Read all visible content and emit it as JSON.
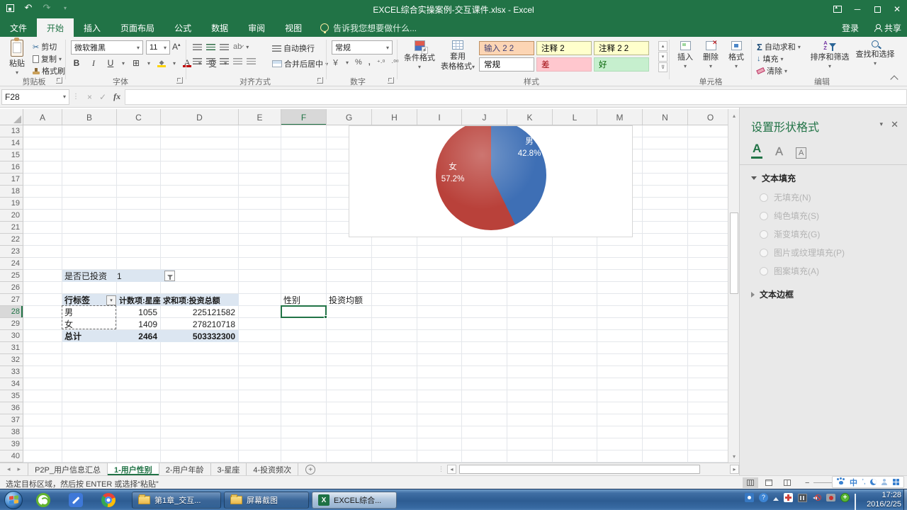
{
  "window": {
    "title": "EXCEL综合实操案例-交互课件.xlsx - Excel",
    "signin_label": "登录",
    "share_label": "共享"
  },
  "ribbon_tabs": [
    {
      "label": "文件",
      "kind": "file"
    },
    {
      "label": "开始",
      "active": true
    },
    {
      "label": "插入"
    },
    {
      "label": "页面布局"
    },
    {
      "label": "公式"
    },
    {
      "label": "数据"
    },
    {
      "label": "审阅"
    },
    {
      "label": "视图"
    }
  ],
  "tell_me": "告诉我您想要做什么...",
  "ribbon": {
    "clipboard": {
      "label": "剪贴板",
      "paste": "粘贴",
      "cut": "剪切",
      "copy": "复制",
      "painter": "格式刷"
    },
    "font": {
      "label": "字体",
      "font_name": "微软雅黑",
      "font_size": "11",
      "bold": "B",
      "italic": "I",
      "underline": "U",
      "phonetic": "变"
    },
    "alignment": {
      "label": "对齐方式",
      "wrap": "自动换行",
      "merge": "合并后居中"
    },
    "number": {
      "label": "数字",
      "format": "常规",
      "percent": "%",
      "comma": ",",
      "inc_dec": "+.0 .00"
    },
    "styles": {
      "label": "样式",
      "conditional": "条件格式",
      "format_table_1": "套用",
      "format_table_2": "表格格式",
      "gallery": [
        {
          "label": "输入 2 2",
          "bg": "#FCD5B4",
          "fg": "#3F3F76",
          "border": "#bd8f62"
        },
        {
          "label": "注释 2",
          "bg": "#FFFFCC",
          "fg": "#000000",
          "border": "#b8b88a"
        },
        {
          "label": "注释 2 2",
          "bg": "#FFFFCC",
          "fg": "#000000",
          "border": "#b8b88a"
        },
        {
          "label": "常规",
          "bg": "#FFFFFF",
          "fg": "#000000",
          "border": "#ababab"
        },
        {
          "label": "差",
          "bg": "#FFC7CE",
          "fg": "#9C0006",
          "border": "#eab6bd"
        },
        {
          "label": "好",
          "bg": "#C6EFCE",
          "fg": "#006100",
          "border": "#aedcb8"
        }
      ]
    },
    "cells": {
      "label": "单元格",
      "insert": "插入",
      "delete": "删除",
      "format": "格式"
    },
    "editing": {
      "label": "编辑",
      "autosum": "自动求和",
      "fill": "填充",
      "clear": "清除",
      "sort": "排序和筛选",
      "find": "查找和选择"
    }
  },
  "formula_bar": {
    "name_box": "F28",
    "fx": "fx"
  },
  "grid": {
    "columns": [
      "A",
      "B",
      "C",
      "D",
      "E",
      "F",
      "G",
      "H",
      "I",
      "J",
      "K",
      "L",
      "M",
      "N",
      "O"
    ],
    "row_first": 13,
    "row_last": 40,
    "selected_column": "F",
    "selected_row": 28
  },
  "cells": {
    "f27": "性别",
    "g27": "投资均额"
  },
  "pivot": {
    "filter_field": "是否已投资",
    "filter_value": "1",
    "headers": [
      "行标签",
      "计数项:星座",
      "求和项:投资总额"
    ],
    "rows": [
      [
        "男",
        "1055",
        "225121582"
      ],
      [
        "女",
        "1409",
        "278210718"
      ]
    ],
    "total": [
      "总计",
      "2464",
      "503332300"
    ]
  },
  "chart_data": {
    "type": "pie",
    "categories": [
      "男",
      "女"
    ],
    "values": [
      42.8,
      57.2
    ],
    "unit": "%",
    "colors": [
      "#3E6FB5",
      "#B9413A"
    ],
    "data_labels": [
      [
        "男",
        "42.8%"
      ],
      [
        "女",
        "57.2%"
      ]
    ],
    "legend_position": "none"
  },
  "format_pane": {
    "title": "设置形状格式",
    "icon_tabs": [
      "text-fill-outline-icon",
      "text-effects-icon",
      "textbox-icon"
    ],
    "sections": [
      {
        "title": "文本填充",
        "expanded": true,
        "options": [
          "无填充(N)",
          "纯色填充(S)",
          "渐变填充(G)",
          "图片或纹理填充(P)",
          "图案填充(A)"
        ]
      },
      {
        "title": "文本边框",
        "expanded": false,
        "options": []
      }
    ]
  },
  "sheet_tabs": [
    {
      "label": "P2P_用户信息汇总"
    },
    {
      "label": "1-用户性别",
      "active": true
    },
    {
      "label": "2-用户年龄"
    },
    {
      "label": "3-星座"
    },
    {
      "label": "4-投资频次"
    }
  ],
  "status_bar": {
    "message": "选定目标区域，然后按 ENTER 或选择“粘贴”"
  },
  "ime_bar": {
    "mode": "中",
    "punctuation": "’,"
  },
  "taskbar": {
    "buttons": [
      {
        "label": "第1章_交互...",
        "icon": "folder"
      },
      {
        "label": "屏幕截图",
        "icon": "folder"
      },
      {
        "label": "EXCEL综合...",
        "icon": "excel",
        "active": true
      }
    ],
    "clock": {
      "time": "17:28",
      "date": "2016/2/25"
    }
  }
}
